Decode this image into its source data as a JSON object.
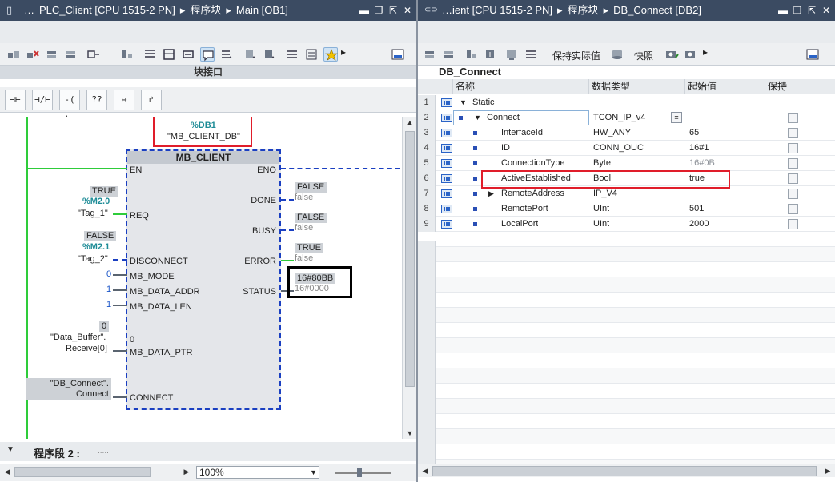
{
  "left": {
    "title": [
      "…",
      "PLC_Client [CPU 1515-2 PN]",
      "▸",
      "程序块",
      "▸",
      "Main [OB1]"
    ],
    "block_interface_label": "块接口",
    "ladder_buttons": [
      "⊣⊢",
      "⊣/⊢",
      "-( )-",
      "??",
      "↦",
      "↱"
    ],
    "block": {
      "db_addr": "%DB1",
      "db_name": "\"MB_CLIENT_DB\"",
      "name": "MB_CLIENT",
      "en": "EN",
      "eno": "ENO",
      "inputs": [
        "REQ",
        "DISCONNECT",
        "MB_MODE",
        "MB_DATA_ADDR",
        "MB_DATA_LEN",
        "MB_DATA_PTR",
        "CONNECT"
      ],
      "outputs": [
        "DONE",
        "BUSY",
        "ERROR",
        "STATUS"
      ]
    },
    "operands": {
      "req_state": "TRUE",
      "req_addr": "%M2.0",
      "req_tag": "\"Tag_1\"",
      "disc_state": "FALSE",
      "disc_addr": "%M2.1",
      "disc_tag": "\"Tag_2\"",
      "mode_val": "0",
      "addr_val": "1",
      "len_val": "1",
      "ptr_state": "0",
      "ptr_tag_1": "\"Data_Buffer\".",
      "ptr_tag_2": "Receive[0]",
      "ptr_inner": "0",
      "connect_1": "\"DB_Connect\".",
      "connect_2": "Connect"
    },
    "outputs": {
      "done_state": "FALSE",
      "done_val": "false",
      "busy_state": "FALSE",
      "busy_val": "false",
      "error_state": "TRUE",
      "error_val": "false",
      "status_state": "16#80BB",
      "status_val": "16#0000"
    },
    "network": "程序段 2 :",
    "network_dots": ".....",
    "zoom": "100%"
  },
  "right": {
    "title": [
      "…ient [CPU 1515-2 PN]",
      "▸",
      "程序块",
      "▸",
      "DB_Connect [DB2]"
    ],
    "toolbar": {
      "keep_actual": "保持实际值",
      "snapshot": "快照"
    },
    "db_name": "DB_Connect",
    "columns": [
      "名称",
      "数据类型",
      "起始值",
      "保持"
    ],
    "rows": [
      {
        "n": "1",
        "name": "Static",
        "type": "",
        "start": "",
        "indent": 0,
        "caret": "▼"
      },
      {
        "n": "2",
        "name": "Connect",
        "type": "TCON_IP_v4",
        "start": "",
        "indent": 1,
        "caret": "▼"
      },
      {
        "n": "3",
        "name": "InterfaceId",
        "type": "HW_ANY",
        "start": "65",
        "indent": 2,
        "caret": ""
      },
      {
        "n": "4",
        "name": "ID",
        "type": "CONN_OUC",
        "start": "16#1",
        "indent": 2,
        "caret": ""
      },
      {
        "n": "5",
        "name": "ConnectionType",
        "type": "Byte",
        "start": "16#0B",
        "indent": 2,
        "caret": ""
      },
      {
        "n": "6",
        "name": "ActiveEstablished",
        "type": "Bool",
        "start": "true",
        "indent": 2,
        "caret": ""
      },
      {
        "n": "7",
        "name": "RemoteAddress",
        "type": "IP_V4",
        "start": "",
        "indent": 2,
        "caret": "▶"
      },
      {
        "n": "8",
        "name": "RemotePort",
        "type": "UInt",
        "start": "501",
        "indent": 2,
        "caret": ""
      },
      {
        "n": "9",
        "name": "LocalPort",
        "type": "UInt",
        "start": "2000",
        "indent": 2,
        "caret": ""
      }
    ]
  },
  "colors": {
    "titlebar": "#3b4b62",
    "power_flow": "#2ecc3a",
    "no_flow": "#1a3fc1",
    "highlight": "#e01d2a",
    "operand": "#1e8c97"
  }
}
